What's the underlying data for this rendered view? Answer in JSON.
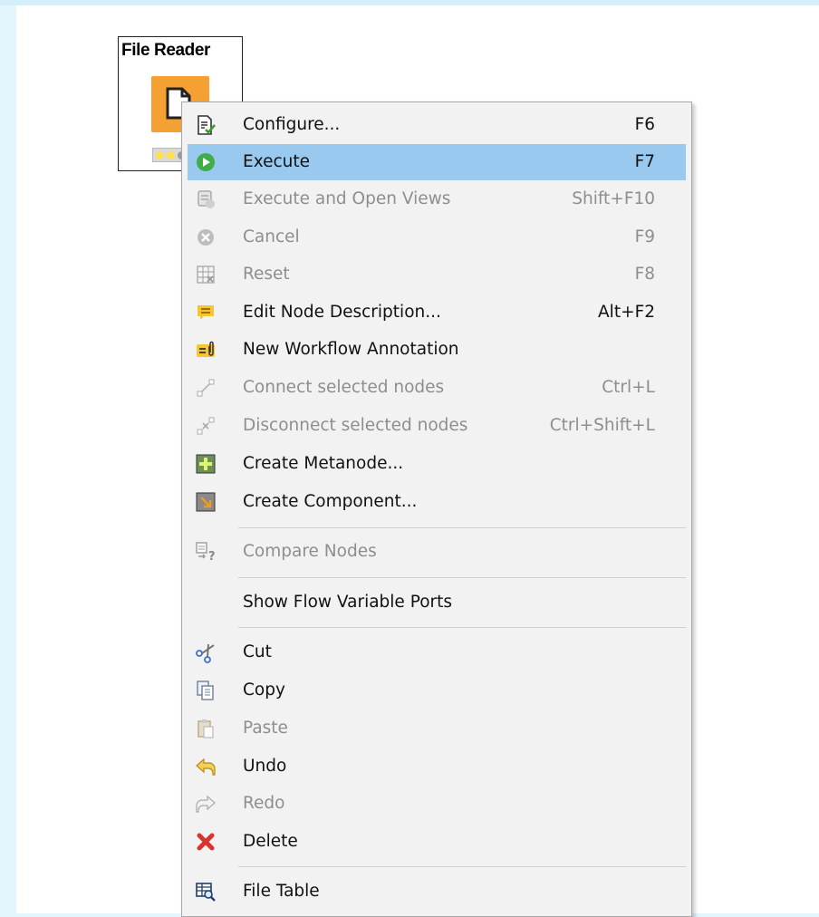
{
  "node": {
    "title": "File Reader",
    "icon": "file-reader-node-icon",
    "status_lights": [
      "#ffe04d",
      "#ffe04d",
      "#9a9a9a"
    ]
  },
  "menu": {
    "items": [
      {
        "label": "Configure...",
        "shortcut": "F6",
        "icon": "configure-icon",
        "enabled": true,
        "highlighted": false
      },
      {
        "label": "Execute",
        "shortcut": "F7",
        "icon": "execute-icon",
        "enabled": true,
        "highlighted": true
      },
      {
        "label": "Execute and Open Views",
        "shortcut": "Shift+F10",
        "icon": "execute-open-views-icon",
        "enabled": false,
        "highlighted": false
      },
      {
        "label": "Cancel",
        "shortcut": "F9",
        "icon": "cancel-icon",
        "enabled": false,
        "highlighted": false
      },
      {
        "label": "Reset",
        "shortcut": "F8",
        "icon": "reset-icon",
        "enabled": false,
        "highlighted": false
      },
      {
        "label": "Edit Node Description...",
        "shortcut": "Alt+F2",
        "icon": "comment-icon",
        "enabled": true,
        "highlighted": false
      },
      {
        "label": "New Workflow Annotation",
        "shortcut": "",
        "icon": "annotation-icon",
        "enabled": true,
        "highlighted": false
      },
      {
        "label": "Connect selected nodes",
        "shortcut": "Ctrl+L",
        "icon": "connect-nodes-icon",
        "enabled": false,
        "highlighted": false
      },
      {
        "label": "Disconnect selected nodes",
        "shortcut": "Ctrl+Shift+L",
        "icon": "disconnect-nodes-icon",
        "enabled": false,
        "highlighted": false
      },
      {
        "label": "Create Metanode...",
        "shortcut": "",
        "icon": "metanode-icon",
        "enabled": true,
        "highlighted": false
      },
      {
        "label": "Create Component...",
        "shortcut": "",
        "icon": "component-icon",
        "enabled": true,
        "highlighted": false
      },
      {
        "label": "Compare Nodes",
        "shortcut": "",
        "icon": "compare-nodes-icon",
        "enabled": false,
        "highlighted": false
      },
      {
        "label": "Show Flow Variable Ports",
        "shortcut": "",
        "icon": "",
        "enabled": true,
        "highlighted": false
      },
      {
        "label": "Cut",
        "shortcut": "",
        "icon": "scissors-icon",
        "enabled": true,
        "highlighted": false
      },
      {
        "label": "Copy",
        "shortcut": "",
        "icon": "copy-icon",
        "enabled": true,
        "highlighted": false
      },
      {
        "label": "Paste",
        "shortcut": "",
        "icon": "paste-icon",
        "enabled": false,
        "highlighted": false
      },
      {
        "label": "Undo",
        "shortcut": "",
        "icon": "undo-icon",
        "enabled": true,
        "highlighted": false
      },
      {
        "label": "Redo",
        "shortcut": "",
        "icon": "redo-icon",
        "enabled": false,
        "highlighted": false
      },
      {
        "label": "Delete",
        "shortcut": "",
        "icon": "delete-icon",
        "enabled": true,
        "highlighted": false
      },
      {
        "label": "File Table",
        "shortcut": "",
        "icon": "file-table-icon",
        "enabled": true,
        "highlighted": false
      }
    ]
  },
  "colors": {
    "highlight": "#99c9ef",
    "menu_background": "#f2f2f2",
    "node_orange": "#f5a033",
    "disabled_text": "#8e8e8e"
  }
}
